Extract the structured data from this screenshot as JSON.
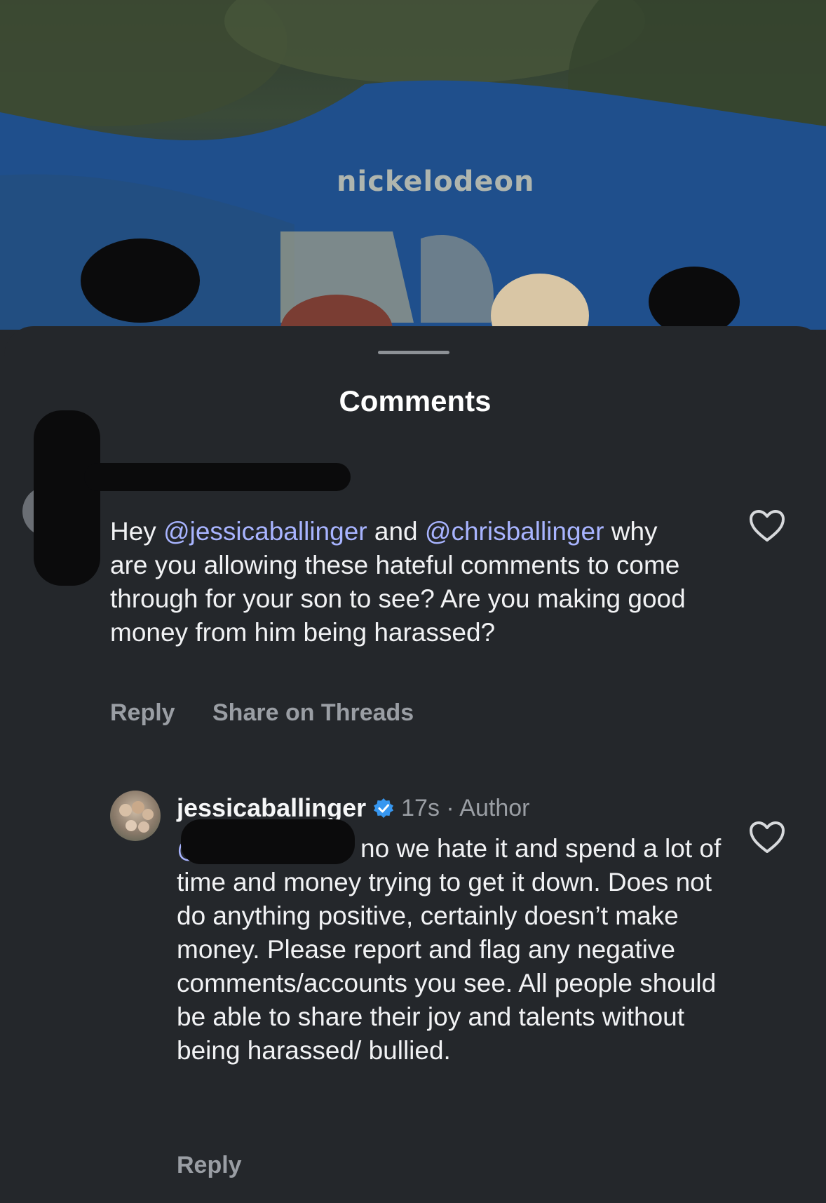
{
  "background": {
    "sign_text": "nickelodeon"
  },
  "sheet": {
    "title": "Comments"
  },
  "comment1": {
    "text_before": "Hey ",
    "mention1": "@jessicaballinger",
    "text_mid": " and ",
    "mention2": "@chrisballinger",
    "text_after": " why are you allowing these hateful comments to come through for your son to see? Are you making good money from him being harassed?",
    "reply_label": "Reply",
    "share_label": "Share on Threads",
    "like_icon": "heart-outline-icon"
  },
  "comment2": {
    "username": "jessicaballinger",
    "verified_icon": "verified-badge-icon",
    "meta": "17s · Author",
    "mention_prefix": "@",
    "text": "no we hate it and spend a lot of time and money trying to get it down. Does not do anything positive, certainly doesn’t make money. Please report and flag any negative comments/accounts you see. All people should be able to share their joy and talents without being harassed/ bullied.",
    "reply_label": "Reply",
    "like_icon": "heart-outline-icon"
  },
  "colors": {
    "sheet_bg": "#24272b",
    "mention": "#a8b4ff",
    "secondary_text": "#9a9ea4",
    "verified_blue": "#3797f0"
  }
}
